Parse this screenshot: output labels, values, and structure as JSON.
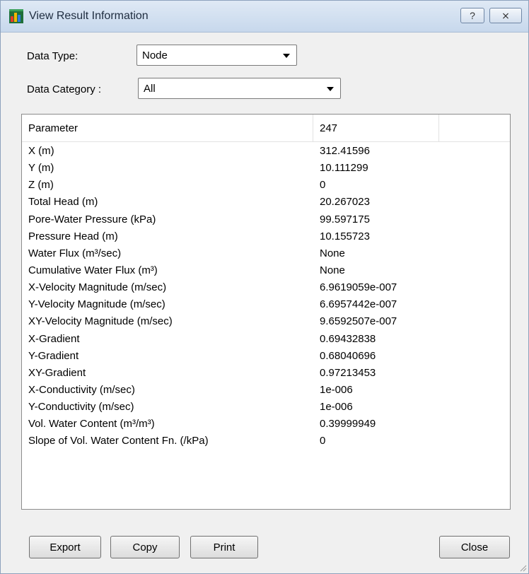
{
  "window": {
    "title": "View Result Information",
    "help_label": "?",
    "close_symbol": "⨯"
  },
  "filters": {
    "data_type_label": "Data Type:",
    "data_type_value": "Node",
    "data_category_label": "Data Category :",
    "data_category_value": "All"
  },
  "table": {
    "headers": [
      "Parameter",
      "247",
      ""
    ],
    "rows": [
      {
        "param": "X (m)",
        "value": "312.41596"
      },
      {
        "param": "Y (m)",
        "value": "10.111299"
      },
      {
        "param": "Z (m)",
        "value": "0"
      },
      {
        "param": "Total Head (m)",
        "value": "20.267023"
      },
      {
        "param": "Pore-Water Pressure (kPa)",
        "value": "99.597175"
      },
      {
        "param": "Pressure Head (m)",
        "value": "10.155723"
      },
      {
        "param": "Water Flux (m³/sec)",
        "value": "None"
      },
      {
        "param": "Cumulative Water Flux (m³)",
        "value": "None"
      },
      {
        "param": "X-Velocity Magnitude (m/sec)",
        "value": "6.9619059e-007"
      },
      {
        "param": "Y-Velocity Magnitude (m/sec)",
        "value": "6.6957442e-007"
      },
      {
        "param": "XY-Velocity Magnitude (m/sec)",
        "value": "9.6592507e-007"
      },
      {
        "param": "X-Gradient",
        "value": "0.69432838"
      },
      {
        "param": "Y-Gradient",
        "value": "0.68040696"
      },
      {
        "param": "XY-Gradient",
        "value": "0.97213453"
      },
      {
        "param": "X-Conductivity (m/sec)",
        "value": "1e-006"
      },
      {
        "param": "Y-Conductivity (m/sec)",
        "value": "1e-006"
      },
      {
        "param": "Vol. Water Content (m³/m³)",
        "value": "0.39999949"
      },
      {
        "param": "Slope of Vol. Water Content Fn. (/kPa)",
        "value": "0"
      }
    ]
  },
  "buttons": {
    "export": "Export",
    "copy": "Copy",
    "print": "Print",
    "close": "Close"
  },
  "icons": {
    "app": "app-icon",
    "dropdown": "chevron-down-icon",
    "resize": "resize-grip-icon"
  },
  "colors": {
    "titlebar": "#c7d8ec",
    "dialog_bg": "#f0f0f0"
  }
}
